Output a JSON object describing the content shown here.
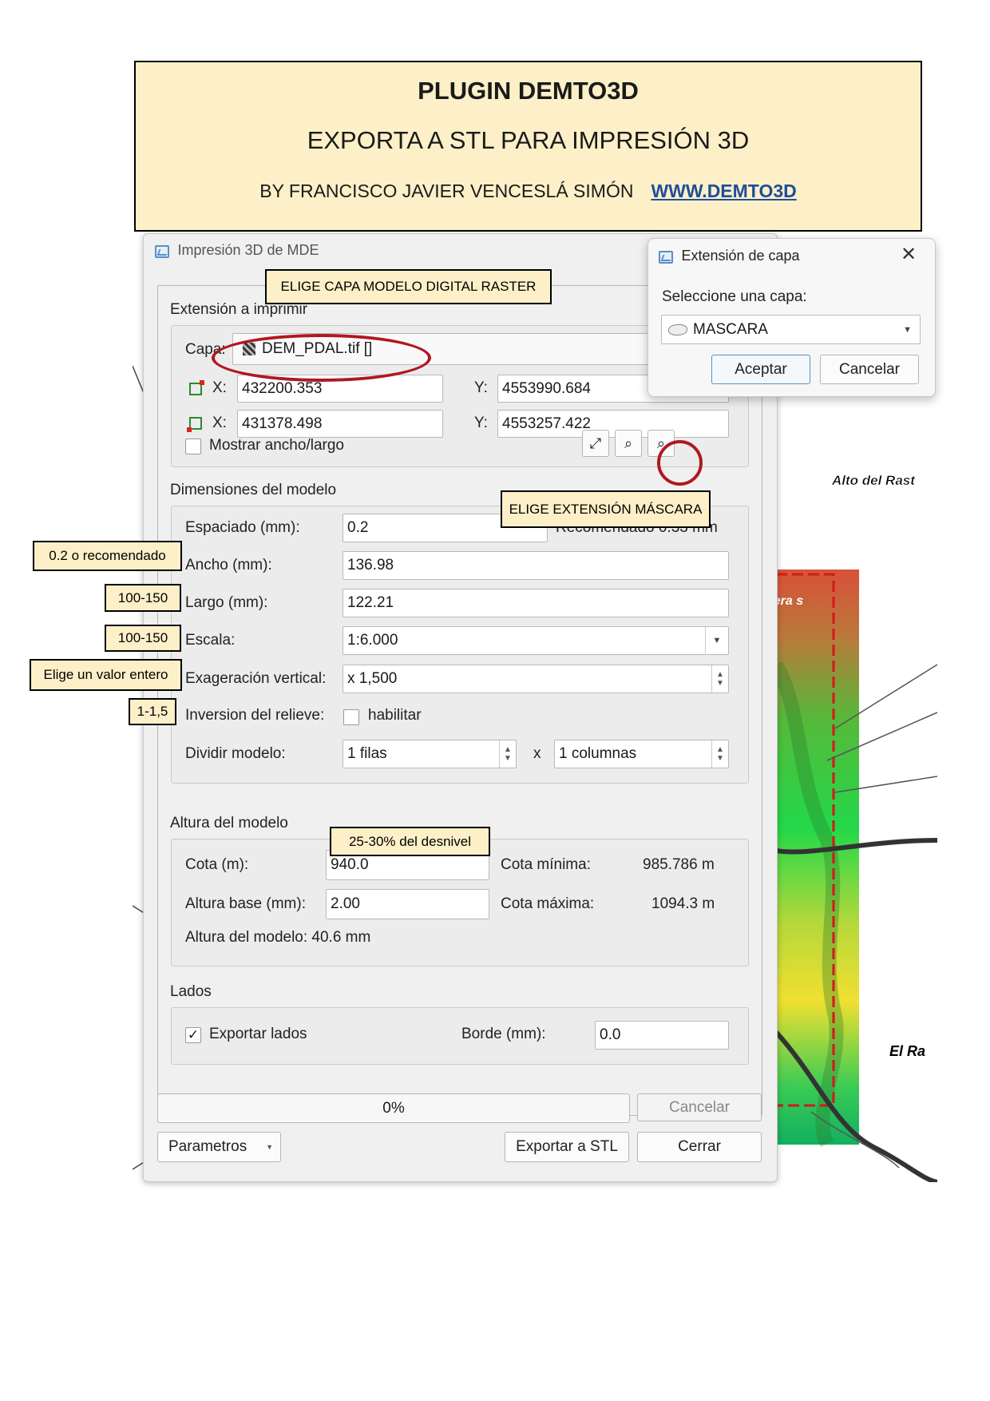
{
  "header": {
    "title": "PLUGIN DEMTO3D",
    "subtitle": "EXPORTA A STL PARA IMPRESIÓN 3D",
    "author": "BY FRANCISCO JAVIER VENCESLÁ SIMÓN",
    "website": "WWW.DEMTO3D"
  },
  "map_labels": {
    "alto": "Alto del Rast",
    "uera": "uera s",
    "el_ra": "El Ra"
  },
  "dialog": {
    "title": "Impresión 3D de MDE",
    "extent_group": "Extensión a imprimir",
    "capa_label": "Capa:",
    "capa_value": "DEM_PDAL.tif []",
    "x_label": "X:",
    "y_label": "Y:",
    "x1": "432200.353",
    "y1": "4553990.684",
    "x2": "431378.498",
    "y2": "4553257.422",
    "show_size": "Mostrar ancho/largo",
    "dims_group": "Dimensiones del modelo",
    "spacing_label": "Espaciado (mm):",
    "spacing_value": "0.2",
    "recommended": "Recomendado  0.33 mm",
    "width_label": "Ancho (mm):",
    "width_value": "136.98",
    "length_label": "Largo (mm):",
    "length_value": "122.21",
    "scale_label": "Escala:",
    "scale_value": "1:6.000",
    "exag_label": "Exageración vertical:",
    "exag_value": "x 1,500",
    "invert_label": "Inversion del relieve:",
    "invert_check": "habilitar",
    "divide_label": "Dividir modelo:",
    "rows_value": "1 filas",
    "times": "x",
    "cols_value": "1 columnas",
    "height_group": "Altura del modelo",
    "cota_label": "Cota (m):",
    "cota_value": "940.0",
    "cota_min_label": "Cota mínima:",
    "cota_min_value": "985.786 m",
    "base_label": "Altura base (mm):",
    "base_value": "2.00",
    "cota_max_label": "Cota máxima:",
    "cota_max_value": "1094.3 m",
    "model_height": "Altura del modelo: 40.6 mm",
    "sides_group": "Lados",
    "export_sides": "Exportar lados",
    "border_label": "Borde (mm):",
    "border_value": "0.0",
    "progress": "0%",
    "cancel": "Cancelar",
    "params": "Parametros",
    "export": "Exportar a STL",
    "close": "Cerrar"
  },
  "mask_dialog": {
    "title": "Extensión de capa",
    "prompt": "Seleccione una capa:",
    "layer": "MASCARA",
    "accept": "Aceptar",
    "cancel": "Cancelar"
  },
  "notes": {
    "raster": "ELIGE CAPA MODELO DIGITAL RASTER",
    "mask": "ELIGE EXTENSIÓN MÁSCARA",
    "spacing": "0.2 o recomendado",
    "width": "100-150",
    "length": "100-150",
    "scale": "Elige un valor entero",
    "exag": "1-1,5",
    "cota": "25-30% del desnivel"
  },
  "colors": {
    "note_bg": "#fdf0c8",
    "highlight_ring": "#b01820",
    "link": "#1f4e9a"
  }
}
